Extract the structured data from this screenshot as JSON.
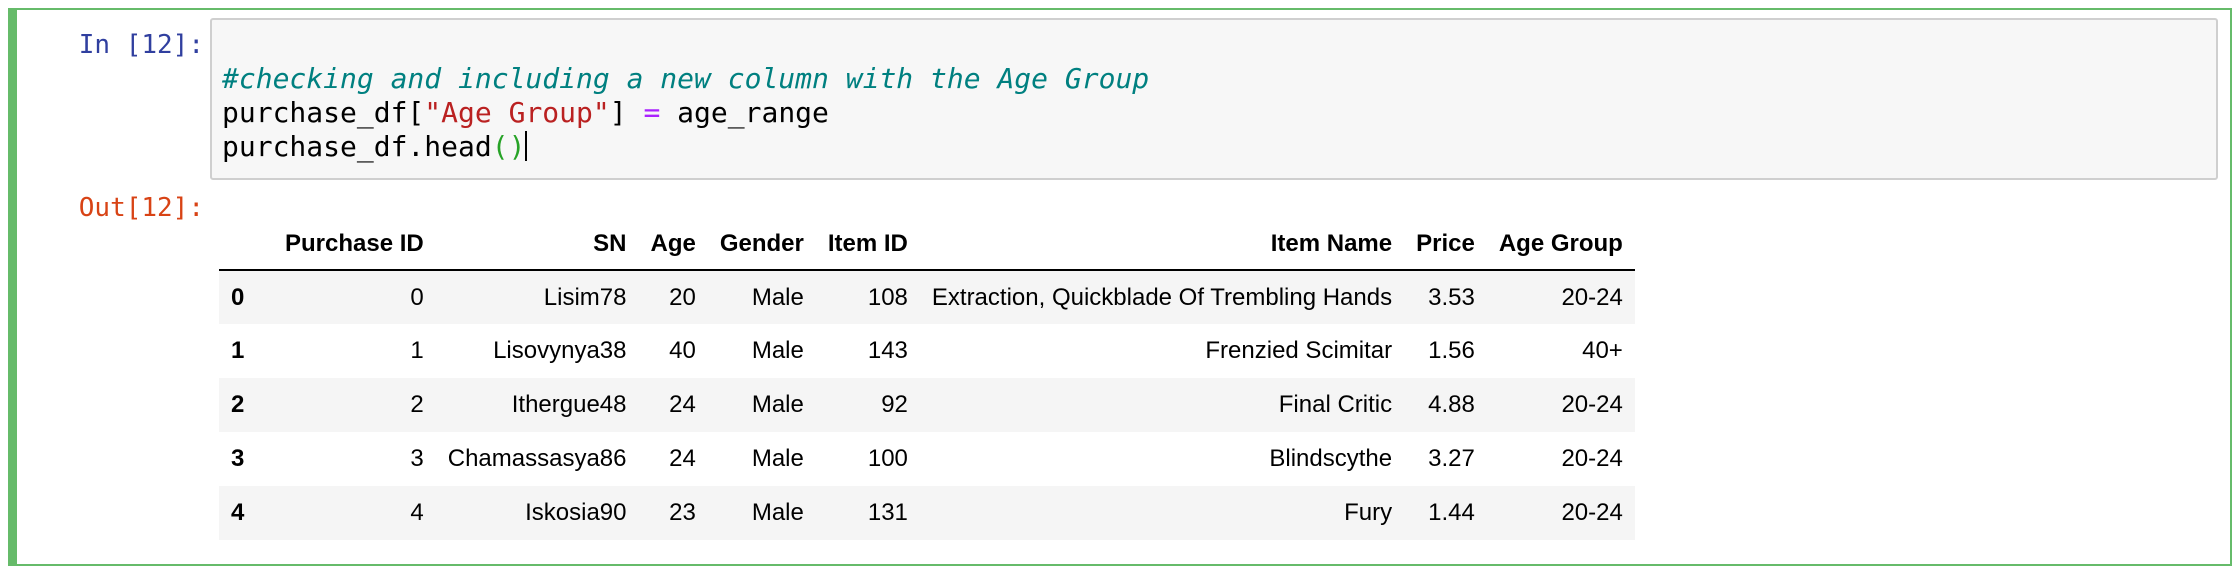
{
  "input_prompt": "In [12]:",
  "output_prompt": "Out[12]:",
  "code": {
    "line1_comment": "#checking and including a new column with the Age Group",
    "line2_var": "purchase_df[",
    "line2_string": "\"Age Group\"",
    "line2_close": "] ",
    "line2_op": "=",
    "line2_rest": " age_range",
    "line3_call": "purchase_df.head",
    "line3_parens": "()"
  },
  "table": {
    "columns": [
      "",
      "Purchase ID",
      "SN",
      "Age",
      "Gender",
      "Item ID",
      "Item Name",
      "Price",
      "Age Group"
    ],
    "rows": [
      [
        "0",
        "0",
        "Lisim78",
        "20",
        "Male",
        "108",
        "Extraction, Quickblade Of Trembling Hands",
        "3.53",
        "20-24"
      ],
      [
        "1",
        "1",
        "Lisovynya38",
        "40",
        "Male",
        "143",
        "Frenzied Scimitar",
        "1.56",
        "40+"
      ],
      [
        "2",
        "2",
        "Ithergue48",
        "24",
        "Male",
        "92",
        "Final Critic",
        "4.88",
        "20-24"
      ],
      [
        "3",
        "3",
        "Chamassasya86",
        "24",
        "Male",
        "100",
        "Blindscythe",
        "3.27",
        "20-24"
      ],
      [
        "4",
        "4",
        "Iskosia90",
        "23",
        "Male",
        "131",
        "Fury",
        "1.44",
        "20-24"
      ]
    ]
  },
  "colors": {
    "cell_border": "#66bb6a",
    "input_prompt": "#303f9f",
    "output_prompt": "#d84315",
    "comment": "#008080",
    "string": "#ba2121",
    "operator": "#aa22ff",
    "parens": "#27a327"
  }
}
